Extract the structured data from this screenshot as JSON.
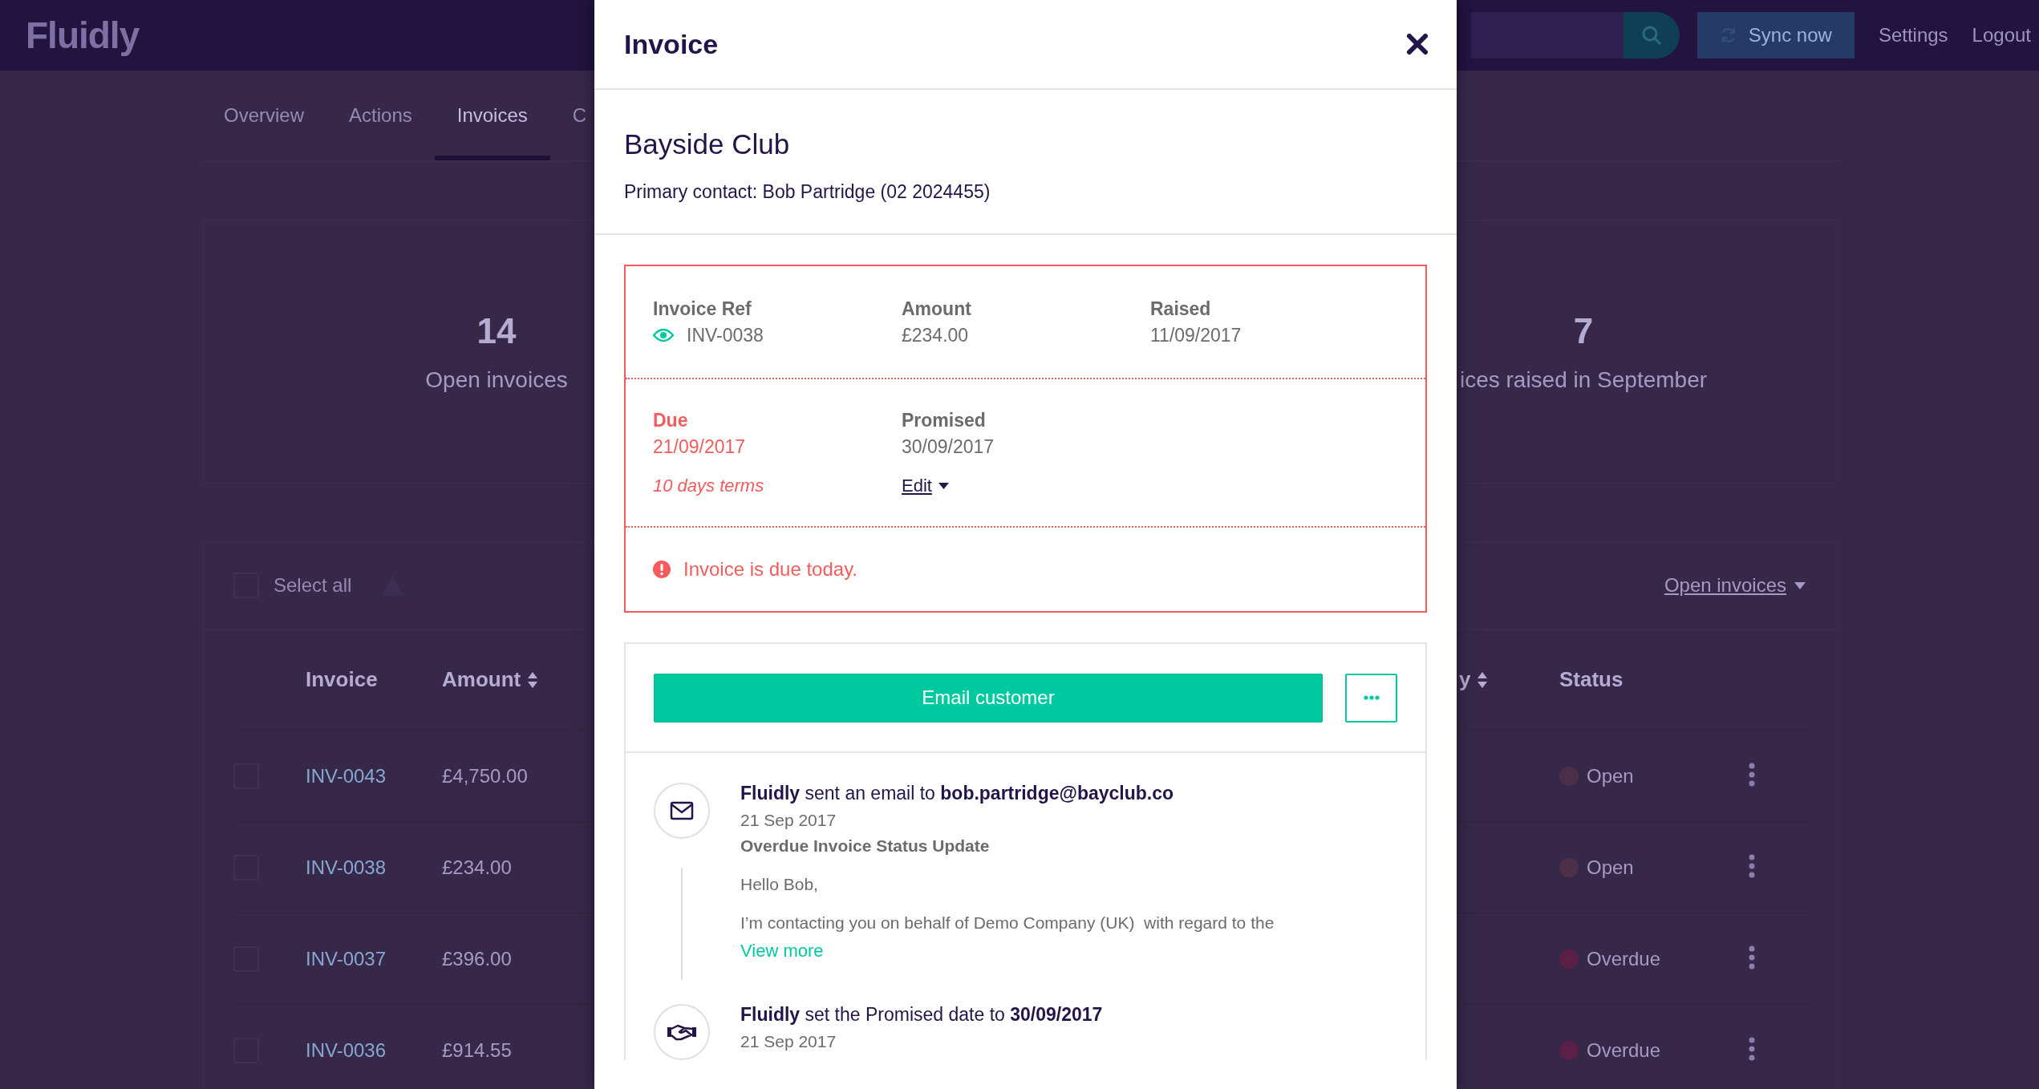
{
  "header": {
    "logo": "Fluidly",
    "sync_button": "Sync now",
    "links": [
      "Settings",
      "Logout"
    ]
  },
  "tabs": [
    {
      "label": "Overview",
      "selected": false
    },
    {
      "label": "Actions",
      "selected": false
    },
    {
      "label": "Invoices",
      "selected": true
    },
    {
      "label": "C",
      "selected": false
    }
  ],
  "stats": [
    {
      "value": "14",
      "label": "Open invoices"
    },
    {
      "value": "7",
      "label": "ices raised in September"
    }
  ],
  "toolbar": {
    "select_all": "Select all",
    "checked": false,
    "filter": "Open invoices"
  },
  "table": {
    "columns": [
      {
        "label": "Invoice",
        "sortable": false
      },
      {
        "label": "Amount",
        "sortable": true
      },
      {
        "label": "y",
        "sortable": true
      },
      {
        "label": "Status",
        "sortable": false
      }
    ],
    "rows": [
      {
        "checked": false,
        "invoice": "INV-0043",
        "amount": "£4,750.00",
        "status": "Open",
        "color": "#4d3048"
      },
      {
        "checked": false,
        "invoice": "INV-0038",
        "amount": "£234.00",
        "status": "Open",
        "color": "#4d3048"
      },
      {
        "checked": false,
        "invoice": "INV-0037",
        "amount": "£396.00",
        "status": "Overdue",
        "color": "#5b1f48"
      },
      {
        "checked": false,
        "invoice": "INV-0036",
        "amount": "£914.55",
        "status": "Overdue",
        "color": "#5b1f48"
      }
    ]
  },
  "modal": {
    "title": "Invoice",
    "customer": "Bayside Club",
    "contact": "Primary contact: Bob Partridge (02 2024455)",
    "details": [
      {
        "label": "Invoice Ref",
        "value": "INV-0038",
        "kind": "ref"
      },
      {
        "label": "Amount",
        "value": "£234.00",
        "kind": "plain"
      },
      {
        "label": "Raised",
        "value": "11/09/2017",
        "kind": "plain"
      }
    ],
    "dates": [
      {
        "label": "Due",
        "value": "21/09/2017",
        "note": "10 days terms",
        "alert": true
      },
      {
        "label": "Promised",
        "value": "30/09/2017",
        "action": "Edit",
        "alert": false
      }
    ],
    "alert": "Invoice is due today.",
    "primary_action": "Email customer",
    "timeline": [
      {
        "kind": "email",
        "text": "**Fluidly** sent an email to **bob.partridge@bayclub.co**",
        "date": "21 Sep 2017",
        "subject": "Overdue Invoice Status Update",
        "body": [
          "Hello Bob,",
          "I’m contacting you on behalf of Demo Company (UK)  with regard to the"
        ],
        "link": "View more"
      },
      {
        "kind": "promise",
        "text": "**Fluidly** set the Promised date to **30/09/2017**",
        "date": "21 Sep 2017"
      }
    ]
  }
}
